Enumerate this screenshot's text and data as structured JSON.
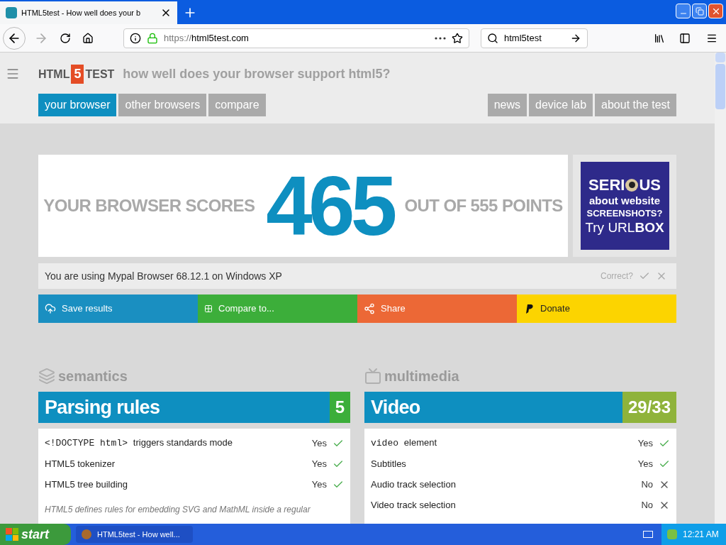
{
  "browser": {
    "tab_title": "HTML5test - How well does your b",
    "url_scheme": "https://",
    "url_host": "html5test.com",
    "search": "html5test"
  },
  "header": {
    "logo_left": "HTML",
    "logo_mid": "5",
    "logo_right": "TEST",
    "tagline": "how well does your browser support html5?"
  },
  "nav_left": [
    {
      "label": "your browser",
      "selected": true
    },
    {
      "label": "other browsers",
      "selected": false
    },
    {
      "label": "compare",
      "selected": false
    }
  ],
  "nav_right": [
    {
      "label": "news",
      "selected": false
    },
    {
      "label": "device lab",
      "selected": false
    },
    {
      "label": "about the test",
      "selected": false
    }
  ],
  "score": {
    "prefix": "YOUR BROWSER SCORES",
    "value": "465",
    "suffix": "OUT OF 555 POINTS"
  },
  "ad": {
    "line_1a": "SERI",
    "line_1b": "US",
    "line_2": "about website",
    "line_3": "SCREENSHOTS?",
    "line_4": "Try URL**BOX**"
  },
  "detected": {
    "text": "You are using Mypal Browser 68.12.1 on Windows XP",
    "question": "Correct?"
  },
  "actions": [
    {
      "label": "Save results",
      "kind": "upload",
      "color": "#1a8fc1"
    },
    {
      "label": "Compare to...",
      "kind": "grid",
      "color": "#3cae3a"
    },
    {
      "label": "Share",
      "kind": "share",
      "color": "#ec6836"
    },
    {
      "label": "Donate",
      "kind": "paypal",
      "color": "#fcd400"
    }
  ],
  "sections": [
    {
      "category": "semantics",
      "kind": "layers",
      "title": "Parsing rules",
      "score": "5",
      "color": "#3cae3a",
      "rows": [
        {
          "code": "<!DOCTYPE html>",
          "label": "triggers standards mode",
          "result": "Yes",
          "passed": true
        },
        {
          "label": "HTML5 tokenizer",
          "result": "Yes",
          "passed": true
        },
        {
          "label": "HTML5 tree building",
          "result": "Yes",
          "passed": true
        }
      ],
      "note": "HTML5 defines rules for embedding SVG and MathML inside a regular"
    },
    {
      "category": "multimedia",
      "kind": "screen",
      "title": "Video",
      "score": "29/33",
      "color": "#8fb33b",
      "rows": [
        {
          "code": "video",
          "label": "element",
          "result": "Yes",
          "passed": true
        },
        {
          "label": "Subtitles",
          "result": "Yes",
          "passed": true
        },
        {
          "label": "Audio track selection",
          "result": "No",
          "passed": false
        },
        {
          "label": "Video track selection",
          "result": "No",
          "passed": false
        }
      ]
    }
  ],
  "taskbar": {
    "start": "start",
    "task": "HTML5test - How well...",
    "clock": "12:21 AM"
  }
}
